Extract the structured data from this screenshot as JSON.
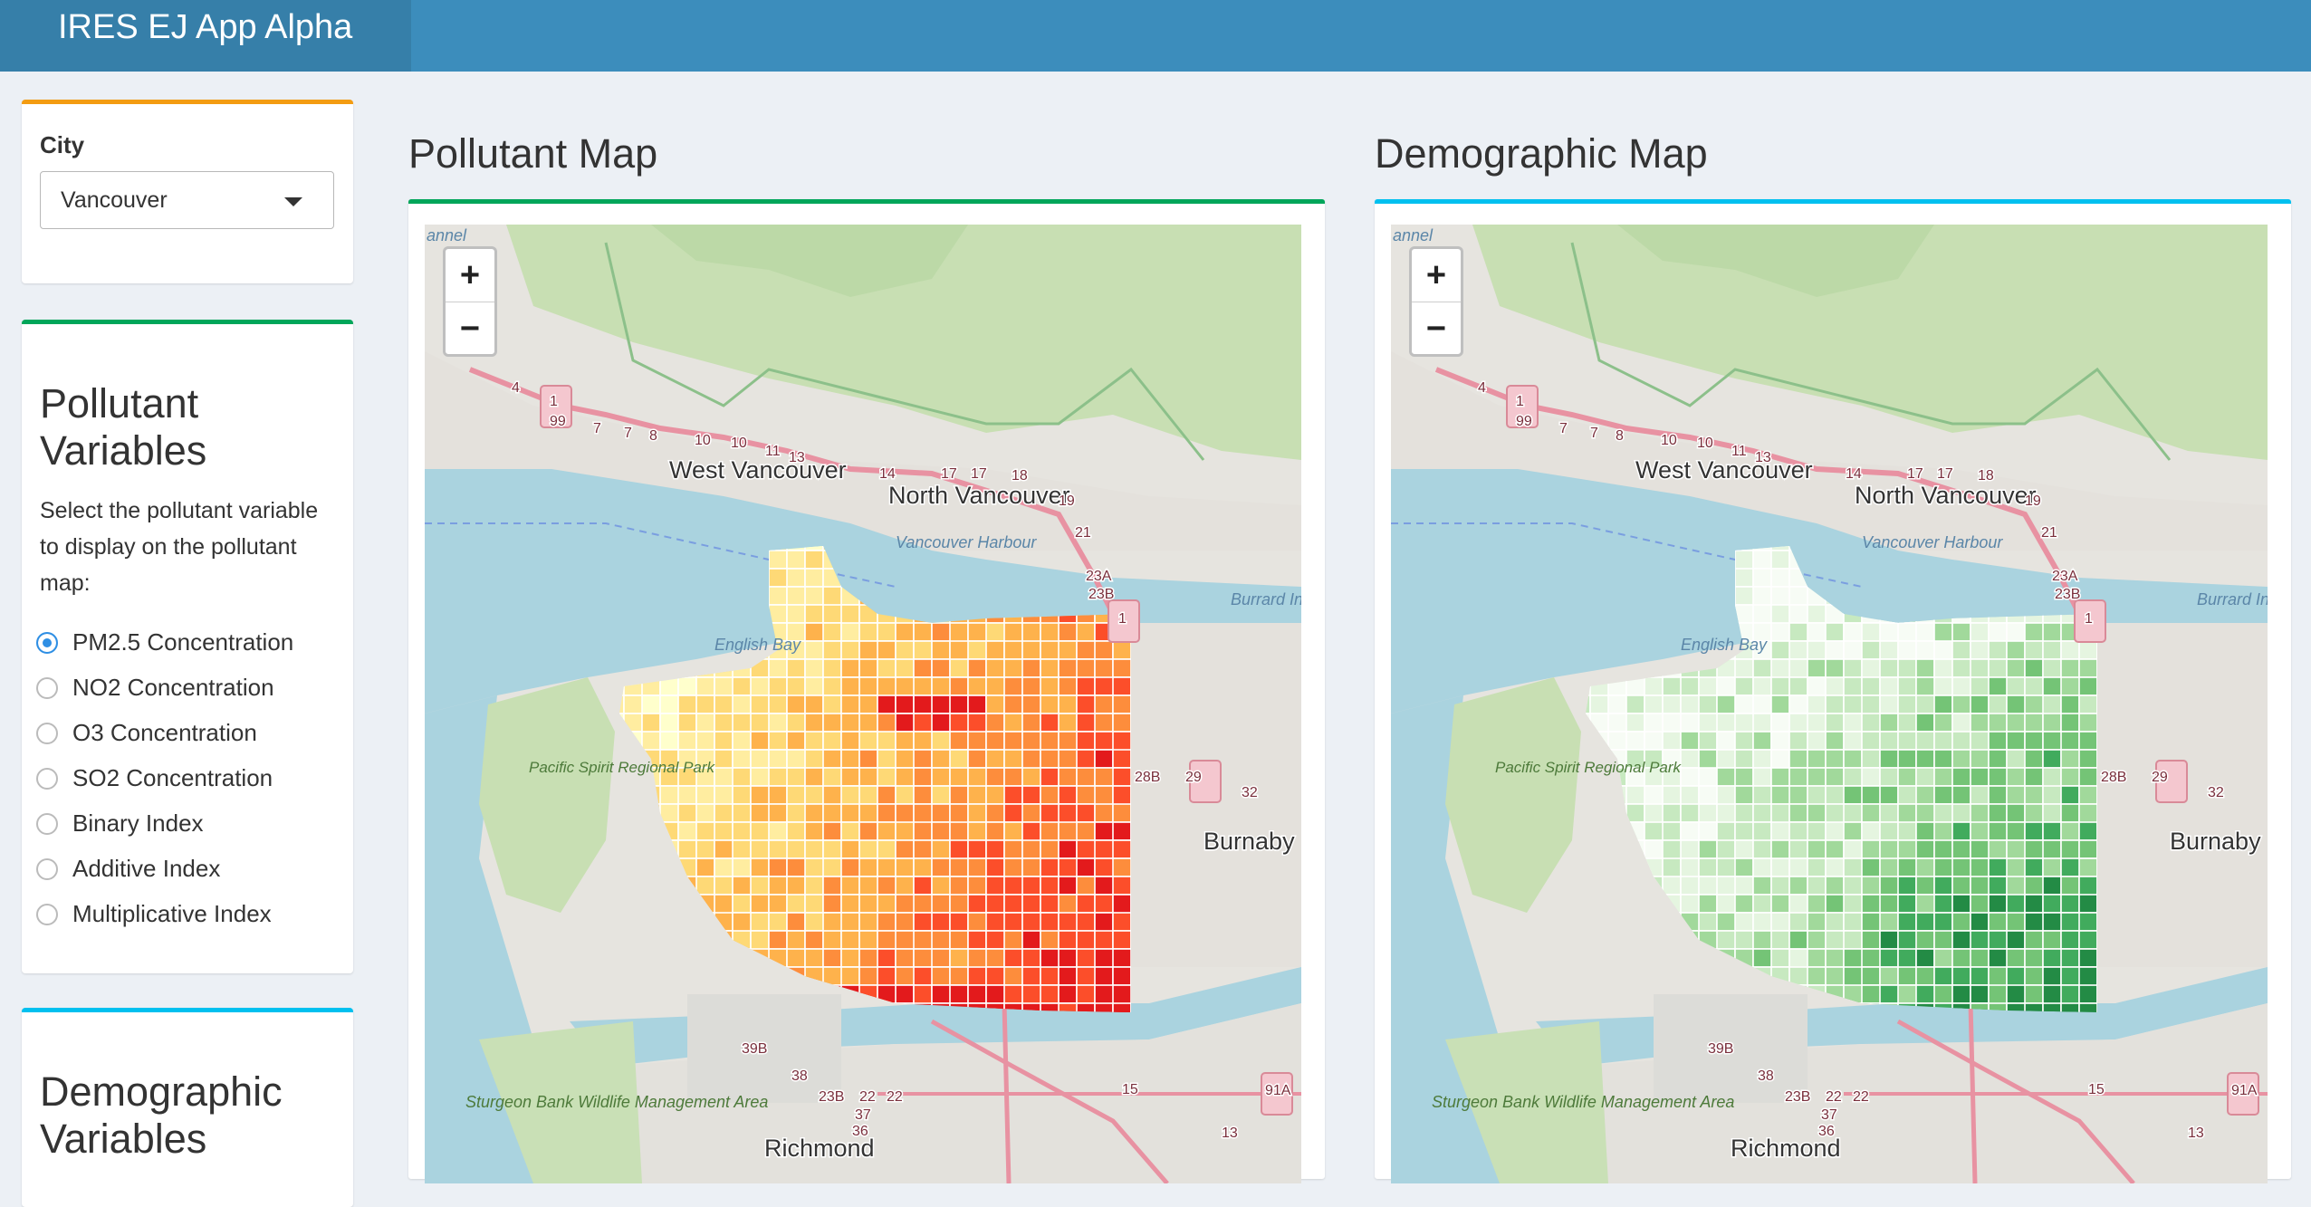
{
  "header": {
    "app_title": "IRES EJ App Alpha"
  },
  "sidebar": {
    "city": {
      "label": "City",
      "selected": "Vancouver"
    },
    "pollutant": {
      "title": "Pollutant Variables",
      "help": "Select the pollutant variable to display on the pollutant map:",
      "options": [
        "PM2.5 Concentration",
        "NO2 Concentration",
        "O3 Concentration",
        "SO2 Concentration",
        "Binary Index",
        "Additive Index",
        "Multiplicative Index"
      ],
      "selected": "PM2.5 Concentration"
    },
    "demographic": {
      "title": "Demographic Variables"
    }
  },
  "maps": {
    "pollutant_title": "Pollutant Map",
    "demographic_title": "Demographic Map",
    "zoom_in": "+",
    "zoom_out": "−",
    "place_labels": {
      "west_vancouver": "West Vancouver",
      "north_vancouver": "North Vancouver",
      "vancouver_harbour": "Vancouver Harbour",
      "english_bay": "English Bay",
      "pacific_spirit": "Pacific Spirit Regional Park",
      "burnaby": "Burnaby",
      "burrard_inlet": "Burrard Inlet",
      "richmond": "Richmond",
      "sturgeon_bank": "Sturgeon Bank Wildlife Management Area",
      "channel": "annel"
    },
    "route_labels": [
      "1",
      "99",
      "4",
      "7",
      "7",
      "8",
      "10",
      "10",
      "11",
      "13",
      "14",
      "17",
      "17",
      "18",
      "19",
      "21",
      "23A",
      "23B",
      "1",
      "28B",
      "29",
      "32",
      "39B",
      "38",
      "23B",
      "22",
      "22",
      "37",
      "36",
      "15",
      "13",
      "91A"
    ]
  },
  "colors": {
    "header": "#3c8dbc",
    "brand": "#367fa9",
    "pm25_low": "#ffffcc",
    "pm25_mid": "#fd8d3c",
    "pm25_high": "#e31a1c",
    "demo_low": "#f7fcf5",
    "demo_high": "#238b45"
  }
}
